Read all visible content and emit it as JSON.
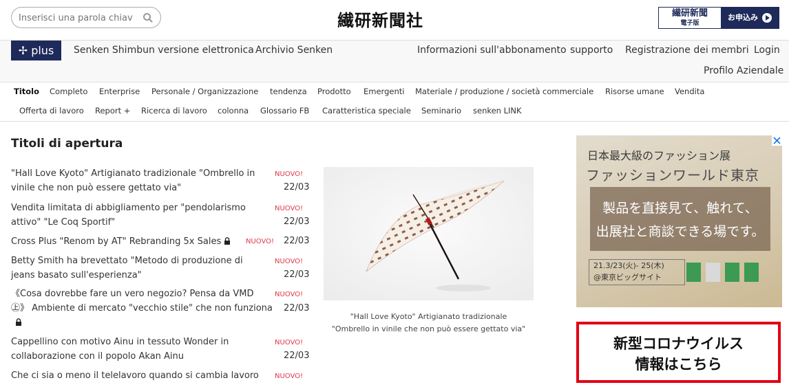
{
  "header": {
    "search_placeholder": "Inserisci una parola chiav",
    "logo": "繊研新聞社",
    "edition_title": "繊研新聞",
    "edition_sub": "電子版",
    "apply_label": "お申込み"
  },
  "nav": {
    "plus": "✢ plus",
    "left_links": [
      "Senken Shimbun versione elettronica",
      "Archivio Senken"
    ],
    "right_links": [
      "Informazioni sull'abbonamento",
      "supporto",
      "Registrazione dei membri",
      "Login"
    ],
    "profile": "Profilo Aziendale"
  },
  "categories": [
    "Titolo",
    "Completo",
    "Enterprise",
    "Personale / Organizzazione",
    "tendenza",
    "Prodotto",
    "Emergenti",
    "Materiale / produzione / società commerciale",
    "Risorse umane",
    "Vendita",
    "Offerta di lavoro",
    "Report +",
    "Ricerca di lavoro",
    "colonna",
    "Glossario FB",
    "Caratteristica speciale",
    "Seminario",
    "senken LINK"
  ],
  "main": {
    "section_title": "Titoli di apertura",
    "new_label": "NUOVO!",
    "articles": [
      {
        "line1": "\"Hall Love Kyoto\" Artigianato tradizionale \"Ombrello in",
        "line2": "vinile che non può essere gettato via\"",
        "date": "22/03"
      },
      {
        "line1": "Vendita limitata di abbigliamento per \"pendolarismo",
        "line2": "attivo\" \"Le Coq Sportif\"",
        "date": "22/03"
      },
      {
        "line1": "Cross Plus \"Renom by AT\" Rebranding 5x Sales",
        "line2": "",
        "date": "22/03"
      },
      {
        "line1": "Betty Smith ha brevettato \"Metodo di produzione di",
        "line2": "jeans basato sull'esperienza\"",
        "date": "22/03"
      },
      {
        "line1": "《Cosa dovrebbe fare un vero negozio? Pensa da VMD",
        "line2": "㊤》 Ambiente di mercato \"vecchio stile\" che non funziona",
        "date": "22/03"
      },
      {
        "line1": "Cappellino con motivo Ainu in tessuto Wonder in",
        "line2": "collaborazione con il popolo Akan Ainu",
        "date": "22/03"
      },
      {
        "line1": "Che ci sia o meno il telelavoro quando si cambia lavoro",
        "line2": "",
        "date": ""
      }
    ],
    "caption_line1": "\"Hall Love Kyoto\" Artigianato tradizionale",
    "caption_line2": "\"Ombrello in vinile che non può essere gettato via\""
  },
  "sidebar": {
    "ad_line1": "日本最大級のファッション展",
    "ad_line2": "ファッションワールド東京",
    "ad_box1": "製品を直接見て、触れて、",
    "ad_box2": "出展社と商談できる場です。",
    "ad_date1": "21.3/23(火)- 25(木)",
    "ad_date2": "@東京ビッグサイト",
    "covid_line1": "新型コロナウイルス",
    "covid_line2": "情報はこちら"
  }
}
